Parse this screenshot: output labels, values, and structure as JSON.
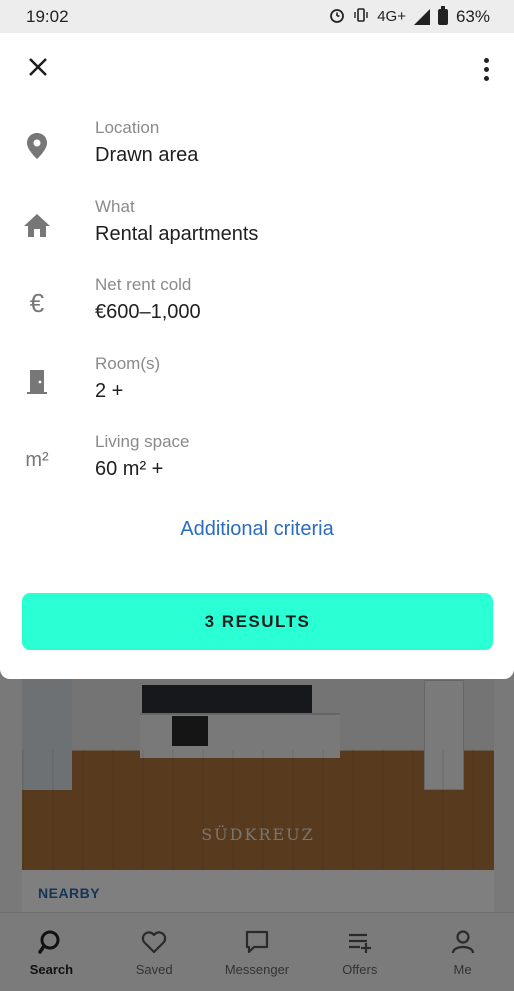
{
  "status_bar": {
    "time": "19:02",
    "network": "4G+",
    "battery": "63%"
  },
  "sheet": {
    "criteria": [
      {
        "icon": "location-pin-icon",
        "label": "Location",
        "value": "Drawn area"
      },
      {
        "icon": "house-icon",
        "label": "What",
        "value": "Rental apartments"
      },
      {
        "icon": "euro-icon",
        "label": "Net rent cold",
        "value": "€600–1,000"
      },
      {
        "icon": "door-icon",
        "label": "Room(s)",
        "value": "2 +"
      },
      {
        "icon": "square-meter-icon",
        "label": "Living space",
        "value": "60 m² +"
      }
    ],
    "euro_glyph": "€",
    "m2_glyph": "m²",
    "additional_link": "Additional criteria",
    "results_button": "3 RESULTS"
  },
  "listing": {
    "watermark": "SÜDKREUZ",
    "nearby": "NEARBY"
  },
  "bottom_nav": [
    {
      "label": "Search",
      "icon": "search-icon",
      "active": true
    },
    {
      "label": "Saved",
      "icon": "heart-icon",
      "active": false
    },
    {
      "label": "Messenger",
      "icon": "chat-icon",
      "active": false
    },
    {
      "label": "Offers",
      "icon": "offers-list-icon",
      "active": false
    },
    {
      "label": "Me",
      "icon": "person-icon",
      "active": false
    }
  ],
  "colors": {
    "accent": "#2bffd4",
    "link": "#2a6cc0",
    "nearby": "#2a6cb0"
  }
}
